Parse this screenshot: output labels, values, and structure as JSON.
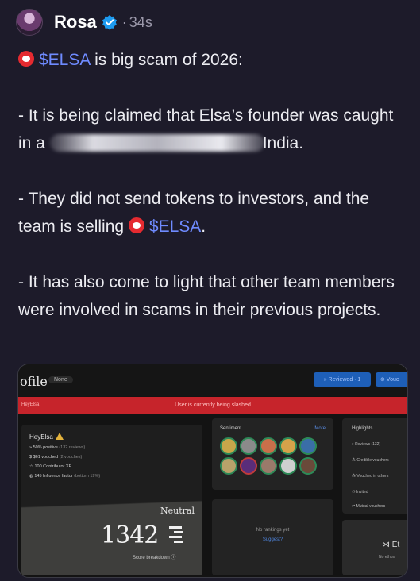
{
  "post": {
    "author": "Rosa",
    "separator": "·",
    "time": "34s",
    "cashtag": "$ELSA",
    "line1_rest": " is big scam of 2026:",
    "p2_start": "- It is being claimed that Elsa’s founder was caught in a",
    "p2_end": "India.",
    "p3_start": "- They did not send tokens to investors, and the team is selling",
    "p3_end": ".",
    "p4": "- It has also come to light that other team members were involved in scams in their previous projects."
  },
  "screenshot": {
    "title": "ofile",
    "none_badge": "None",
    "reviewed_button": "» Reviewed · 1",
    "vouch_button": "⊕ Vouc",
    "slash_left": "HeyElsa",
    "slash_message": "User is currently being slashed",
    "profile": {
      "name": "HeyElsa",
      "stats": [
        {
          "icon": "»",
          "value": "50% positive",
          "detail": "(132 reviews)"
        },
        {
          "icon": "$",
          "value": "$61 vouched",
          "detail": "(2 vouches)"
        },
        {
          "icon": "☆",
          "value": "100 Contributor XP",
          "detail": ""
        },
        {
          "icon": "◍",
          "value": "145 Influence factor",
          "detail": "(bottom 19%)"
        }
      ],
      "level": "Neutral",
      "score": "1342",
      "breakdown": "Score breakdown ⓘ"
    },
    "sentiment": {
      "label": "Sentiment",
      "more": "More"
    },
    "rankings": {
      "no_rankings": "No rankings yet",
      "suggest": "Suggest?"
    },
    "highlights": {
      "label": "Highlights",
      "items": [
        "» Reviews (132)",
        "⁂ Credible vouchers",
        "⁂ Vouched in others",
        "⚇ Invited",
        "⇌ Mutual vouchers"
      ]
    },
    "ethos": {
      "logo": "⋈ Et",
      "no_ethos": "No ethos"
    }
  },
  "colors": {
    "cashtag": "#6f8bff",
    "background": "#1d1b2a",
    "verified": "#1d9bf0",
    "slash_bar": "#c6242b"
  }
}
